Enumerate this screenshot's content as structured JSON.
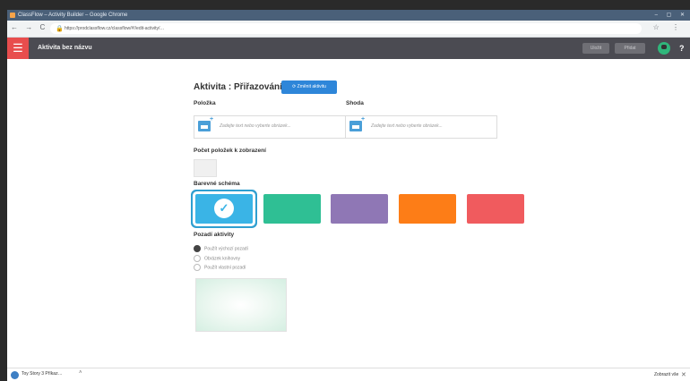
{
  "browser": {
    "window_title": "ClassFlow – Activity Builder – Google Chrome",
    "url": "https://prodclassflow.cz/classflow/#!/edit-activity/…",
    "nav": "← → C",
    "window_controls": "– ▢ ✕",
    "toolbar_icons": "☆ ⋮"
  },
  "app": {
    "title": "Aktivita bez názvu",
    "menu_glyph": "☰",
    "btn_save": "Uložit",
    "btn_second": "Přidat",
    "help": "?"
  },
  "activity": {
    "heading": "Aktivita : Přiřazování",
    "change_button": "Změnit aktivitu",
    "col_item": "Položka",
    "col_match": "Shoda",
    "placeholder_item": "Zadejte text nebo vyberte obrázek...",
    "placeholder_match": "Zadejte text nebo vyberte obrázek...",
    "count_label": "Počet položek k zobrazení",
    "color_label": "Barevné schéma",
    "background_label": "Pozadí aktivity",
    "bg_options": [
      "Použít výchozí pozadí",
      "Obrázek knihovny",
      "Použít vlastní pozadí"
    ],
    "bg_selected_index": 0
  },
  "colors": {
    "swatches": [
      "#3ab4e6",
      "#2fbf94",
      "#8f77b5",
      "#fd7d17",
      "#f05b5e"
    ],
    "selected_index": 0,
    "check_glyph": "✓"
  },
  "downloads": {
    "file_name": "Toy Story 3 Příkaz…",
    "show_all": "Zobrazit vše",
    "chevron": "˄",
    "close": "✕"
  }
}
